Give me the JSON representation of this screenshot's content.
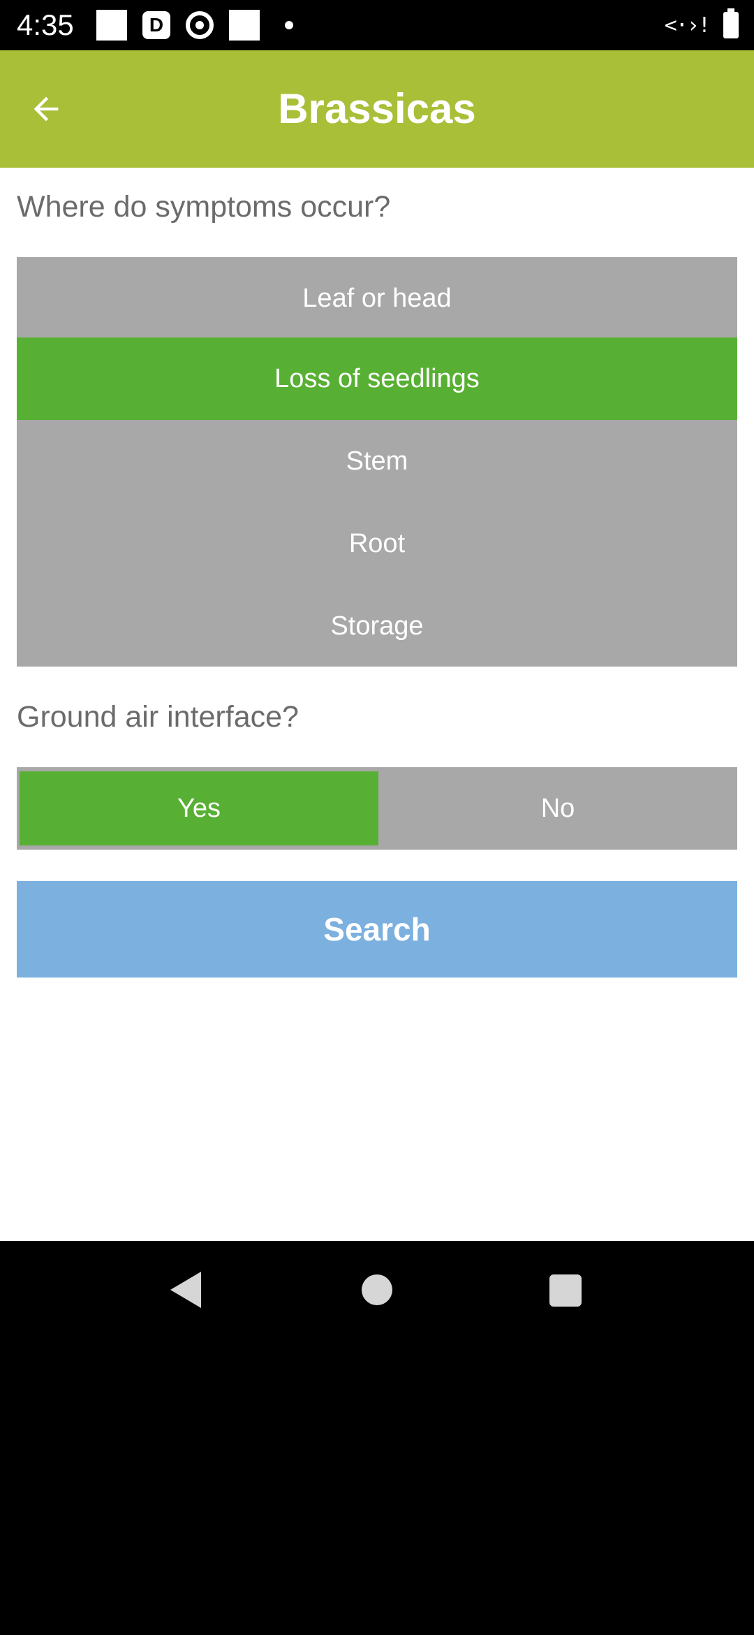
{
  "status_bar": {
    "time": "4:35",
    "left_icons": [
      "square-notification-icon",
      "d-app-icon",
      "target-icon",
      "square-notification-icon",
      "more-dot-icon"
    ],
    "right_icons": [
      "data-arrows-icon",
      "battery-icon"
    ],
    "data_glyph": "<·›!"
  },
  "app_bar": {
    "title": "Brassicas",
    "back_icon": "arrow-left-icon",
    "color": "#a9bf38"
  },
  "symptoms": {
    "question": "Where do symptoms occur?",
    "options": [
      {
        "label": "Leaf or head",
        "selected": false
      },
      {
        "label": "Loss of seedlings",
        "selected": true
      },
      {
        "label": "Stem",
        "selected": false
      },
      {
        "label": "Root",
        "selected": false
      },
      {
        "label": "Storage",
        "selected": false
      }
    ]
  },
  "ground_air": {
    "question": "Ground air interface?",
    "yes_label": "Yes",
    "no_label": "No",
    "selected": "Yes"
  },
  "search": {
    "label": "Search",
    "color": "#7bb0df"
  },
  "colors": {
    "selected_green": "#57b033",
    "unselected_gray": "#a8a8a8",
    "question_text": "#6b6b6b"
  },
  "nav_bar": {
    "icons": [
      "nav-back-icon",
      "nav-home-icon",
      "nav-recents-icon"
    ]
  }
}
